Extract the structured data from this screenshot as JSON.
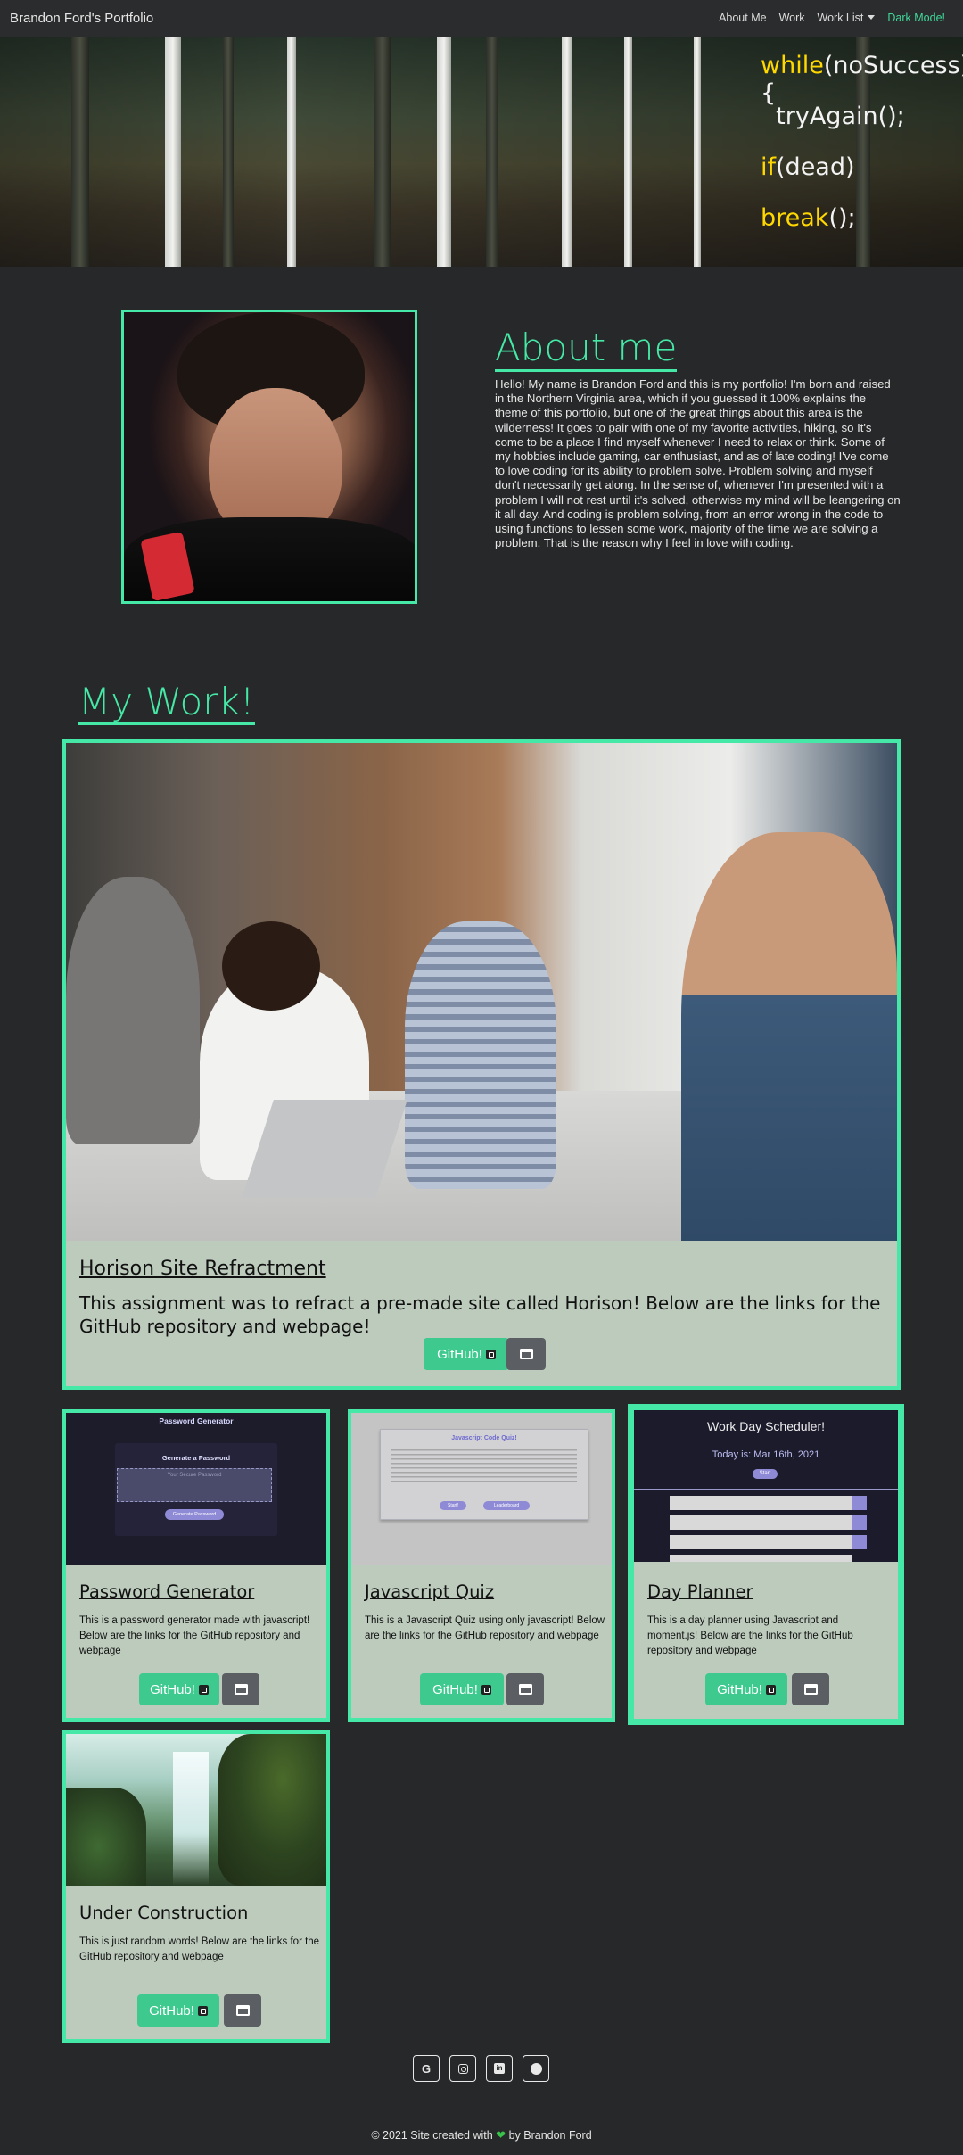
{
  "nav": {
    "brand": "Brandon Ford's Portfolio",
    "links": [
      "About Me",
      "Work",
      "Work List"
    ],
    "dark_mode": "Dark Mode!"
  },
  "hero": {
    "code": [
      {
        "kw": "while",
        "rest": "(noSuccess){"
      },
      {
        "kw": "",
        "rest": "  tryAgain();"
      },
      {
        "kw": "if",
        "rest": "(dead)"
      },
      {
        "kw": "break",
        "rest": "();"
      }
    ]
  },
  "about": {
    "title": "About me",
    "text": "Hello! My name is Brandon Ford and this is my portfolio! I'm born and raised in the Northern Virginia area, which if you guessed it 100% explains the theme of this portfolio, but one of the great things about this area is the wilderness! It goes to pair with one of my favorite activities, hiking, so It's come to be a place I find myself whenever I need to relax or think. Some of my hobbies include gaming, car enthusiast, and as of late coding! I've come to love coding for its ability to problem solve. Problem solving and myself don't necessarily get along. In the sense of, whenever I'm presented with a problem I will not rest until it's solved, otherwise my mind will be leangering on it all day. And coding is problem solving, from an error wrong in the code to using functions to lessen some work, majority of the time we are solving a problem. That is the reason why I feel in love with coding."
  },
  "work": {
    "title": "My Work!",
    "featured": {
      "title": "Horison Site Refractment",
      "text": "This assignment was to refract a pre-made site called Horison! Below are the links for the GitHub repository and webpage!",
      "github": "GitHub!"
    },
    "cards": [
      {
        "title": "Password Generator",
        "text": "This is a password generator made with javascript! Below are the links for the GitHub repository and webpage",
        "github": "GitHub!",
        "img_title": "Password Generator",
        "img_sub": "Generate a Password",
        "img_placeholder": "Your Secure Password",
        "img_button": "Generate Password"
      },
      {
        "title": "Javascript Quiz",
        "text": "This is a Javascript Quiz using only javascript! Below are the links for the GitHub repository and webpage",
        "github": "GitHub!",
        "img_title": "Javascript Code Quiz!",
        "img_button1": "Start!",
        "img_button2": "Leaderboard"
      },
      {
        "title": "Day Planner",
        "text": "This is a day planner using Javascript and moment.js! Below are the links for the GitHub repository and webpage",
        "github": "GitHub!",
        "img_title": "Work Day Scheduler!",
        "img_sub": "Today is: Mar 16th, 2021",
        "img_button": "Start"
      },
      {
        "title": "Under Construction",
        "text": "This is just random words! Below are the links for the GitHub repository and webpage",
        "github": "GitHub!"
      }
    ]
  },
  "social": [
    "google-icon",
    "instagram-icon",
    "linkedin-icon",
    "github-icon"
  ],
  "footer": {
    "before": "© 2021 Site created with",
    "after": "by Brandon Ford"
  },
  "colors": {
    "accent": "#45e8a6",
    "card_bg": "#bdcbbd",
    "page_bg": "#272829",
    "github_button": "#3ec98f",
    "keyword": "#ffd800"
  }
}
